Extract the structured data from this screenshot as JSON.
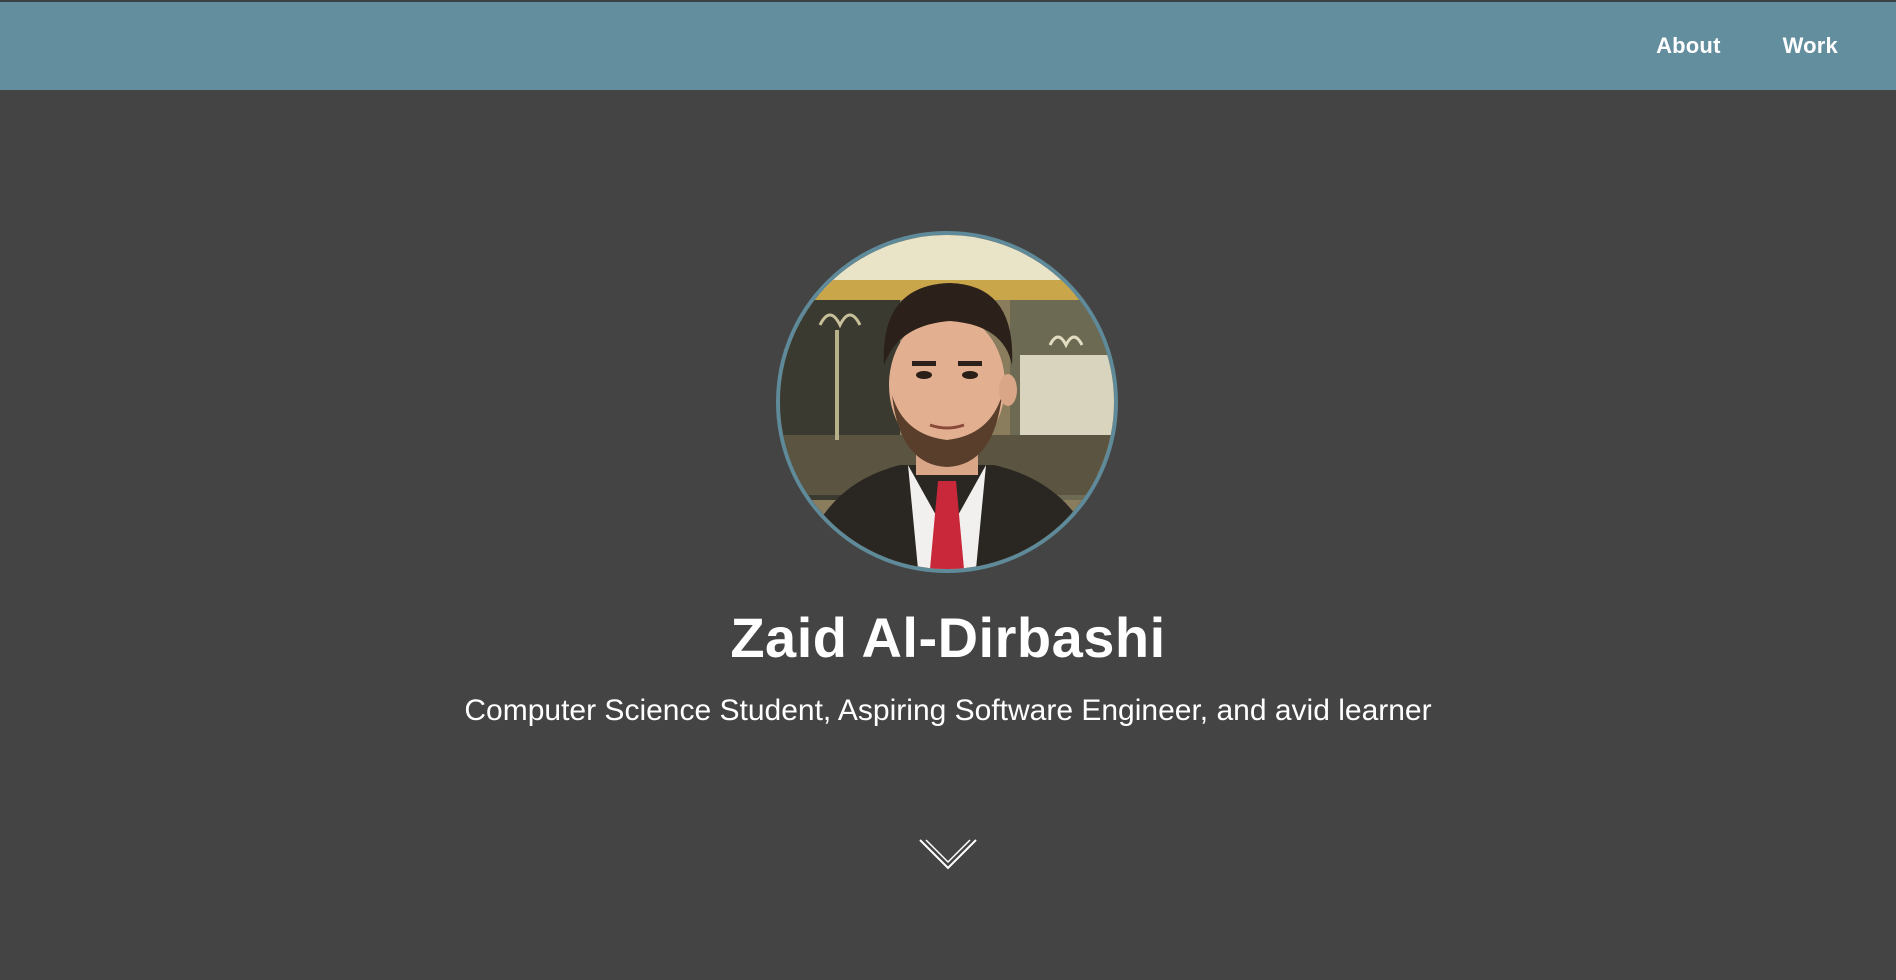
{
  "nav": {
    "links": [
      {
        "label": "About"
      },
      {
        "label": "Work"
      }
    ]
  },
  "hero": {
    "name": "Zaid Al-Dirbashi",
    "tagline": "Computer Science Student, Aspiring Software Engineer, and avid learner",
    "avatar_icon": "profile-photo",
    "scroll_icon": "chevron-down-icon"
  },
  "colors": {
    "navbar": "#628e9d",
    "background": "#444444",
    "accent_border": "#5f8a99",
    "text": "#ffffff"
  }
}
